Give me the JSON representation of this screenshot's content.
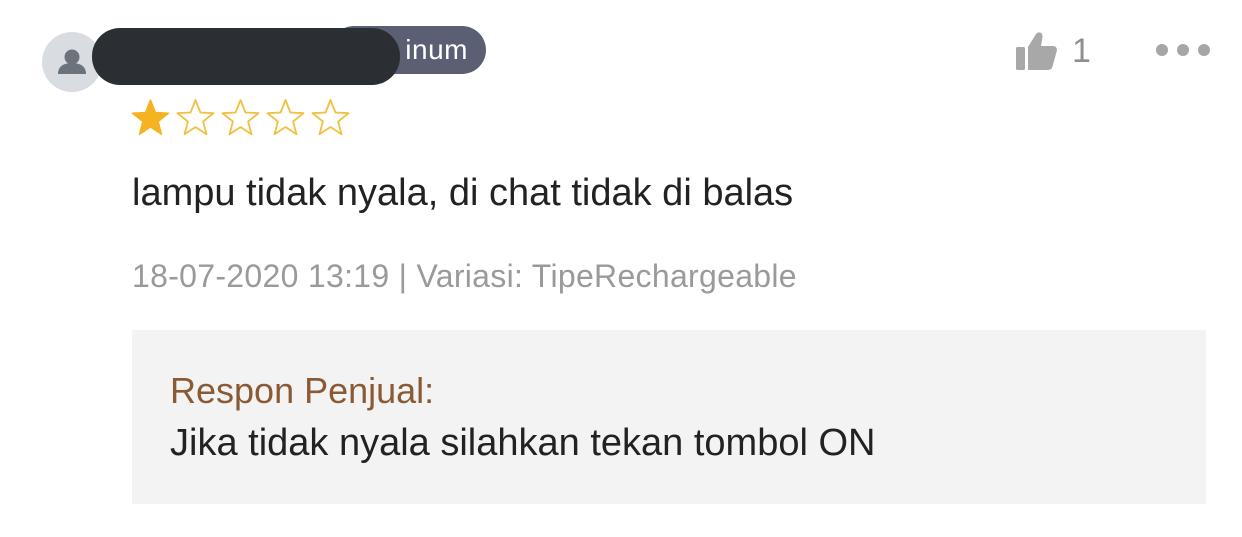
{
  "review": {
    "reviewer": {
      "badge_label": "Platinum",
      "badge_visible_text": "inum",
      "avatar_icon": "user-icon",
      "name_redacted": true
    },
    "rating": {
      "value": 1,
      "max": 5,
      "filled_color": "#f5b321",
      "empty_color": "#f0c040"
    },
    "likes": {
      "icon": "thumbs-up-icon",
      "count": "1"
    },
    "more_icon": "more-horizontal-icon",
    "text": "lampu tidak nyala, di chat tidak di balas",
    "meta": "18-07-2020 13:19 | Variasi: TipeRechargeable"
  },
  "seller_response": {
    "title": "Respon Penjual:",
    "text": "Jika tidak nyala silahkan tekan tombol ON",
    "title_color": "#8a5a34",
    "background_color": "#f3f3f3"
  }
}
